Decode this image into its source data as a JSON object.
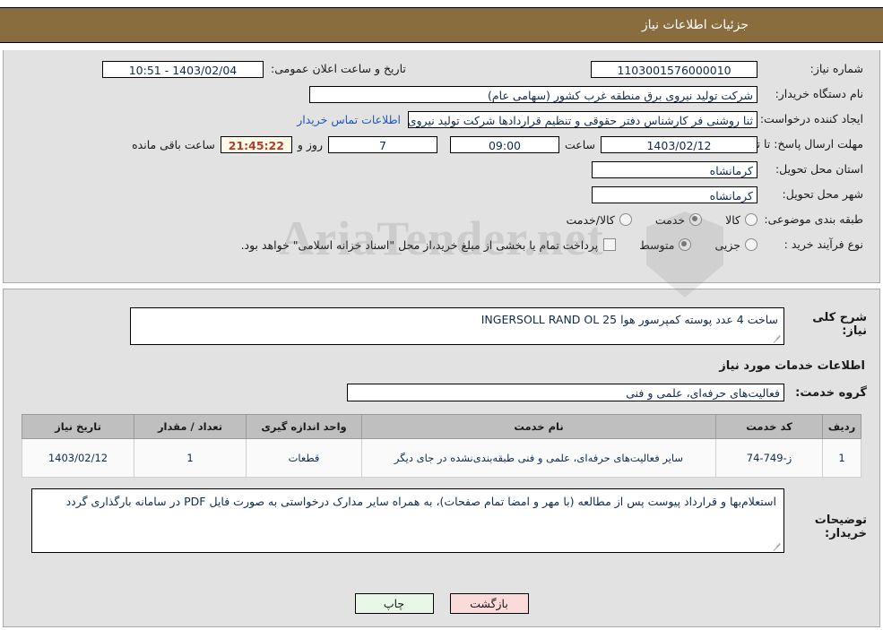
{
  "header": {
    "title": "جزئیات اطلاعات نیاز"
  },
  "top_form": {
    "need_number_label": "شماره نیاز:",
    "need_number_value": "1103001576000010",
    "announce_label": "تاریخ و ساعت اعلان عمومی:",
    "announce_value": "1403/02/04 - 10:51",
    "buyer_org_label": "نام دستگاه خریدار:",
    "buyer_org_value": "شرکت تولید نیروی برق منطقه غرب کشور (سهامی عام)",
    "creator_label": "ایجاد کننده درخواست:",
    "creator_value": "ثنا روشنی فر کارشناس دفتر حقوقی و تنظیم قراردادها شرکت تولید نیروی برق د",
    "contact_link": "اطلاعات تماس خریدار",
    "deadline_label": "مهلت ارسال پاسخ: تا تاریخ:",
    "deadline_date": "1403/02/12",
    "time_label": "ساعت",
    "time_value": "09:00",
    "days_value": "7",
    "days_label": "روز و",
    "countdown_value": "21:45:22",
    "countdown_label": "ساعت باقی مانده",
    "province_label": "استان محل تحویل:",
    "province_value": "کرمانشاه",
    "city_label": "شهر محل تحویل:",
    "city_value": "کرمانشاه",
    "category_label": "طبقه بندی موضوعی:",
    "category_options": [
      {
        "label": "کالا",
        "selected": false
      },
      {
        "label": "خدمت",
        "selected": true
      },
      {
        "label": "کالا/خدمت",
        "selected": false
      }
    ],
    "process_label": "نوع فرآیند خرید :",
    "process_options": [
      {
        "label": "جزیی",
        "selected": false
      },
      {
        "label": "متوسط",
        "selected": true
      }
    ],
    "payment_checkbox_checked": false,
    "payment_note": "پرداخت تمام یا بخشی از مبلغ خرید،از محل \"اسناد خزانه اسلامی\" خواهد بود."
  },
  "watermark": {
    "text": "AriaTender.net"
  },
  "body": {
    "general_desc_label": "شرح کلی نیاز:",
    "general_desc_value": "ساخت 4 عدد پوسته کمپرسور هوا INGERSOLL RAND OL 25",
    "services_section_title": "اطلاعات خدمات مورد نیاز",
    "service_group_label": "گروه خدمت:",
    "service_group_value": "فعالیت‌های حرفه‌ای، علمی و فنی"
  },
  "table": {
    "headers": [
      "ردیف",
      "کد خدمت",
      "نام خدمت",
      "واحد اندازه گیری",
      "تعداد / مقدار",
      "تاریخ نیاز"
    ],
    "rows": [
      {
        "radif": "1",
        "code": "ز-749-74",
        "name": "سایر فعالیت‌های حرفه‌ای، علمی و فنی طبقه‌بندی‌نشده در جای دیگر",
        "unit": "قطعات",
        "qty": "1",
        "date": "1403/02/12"
      }
    ]
  },
  "notes": {
    "label": "توضیحات خریدار:",
    "value": "استعلام‌بها و قرارداد پیوست پس از مطالعه (با مهر و امضا تمام صفحات)، به همراه سایر مدارک درخواستی به صورت فایل PDF در سامانه بارگذاری گردد"
  },
  "footer": {
    "print_label": "چاپ",
    "back_label": "بازگشت"
  }
}
